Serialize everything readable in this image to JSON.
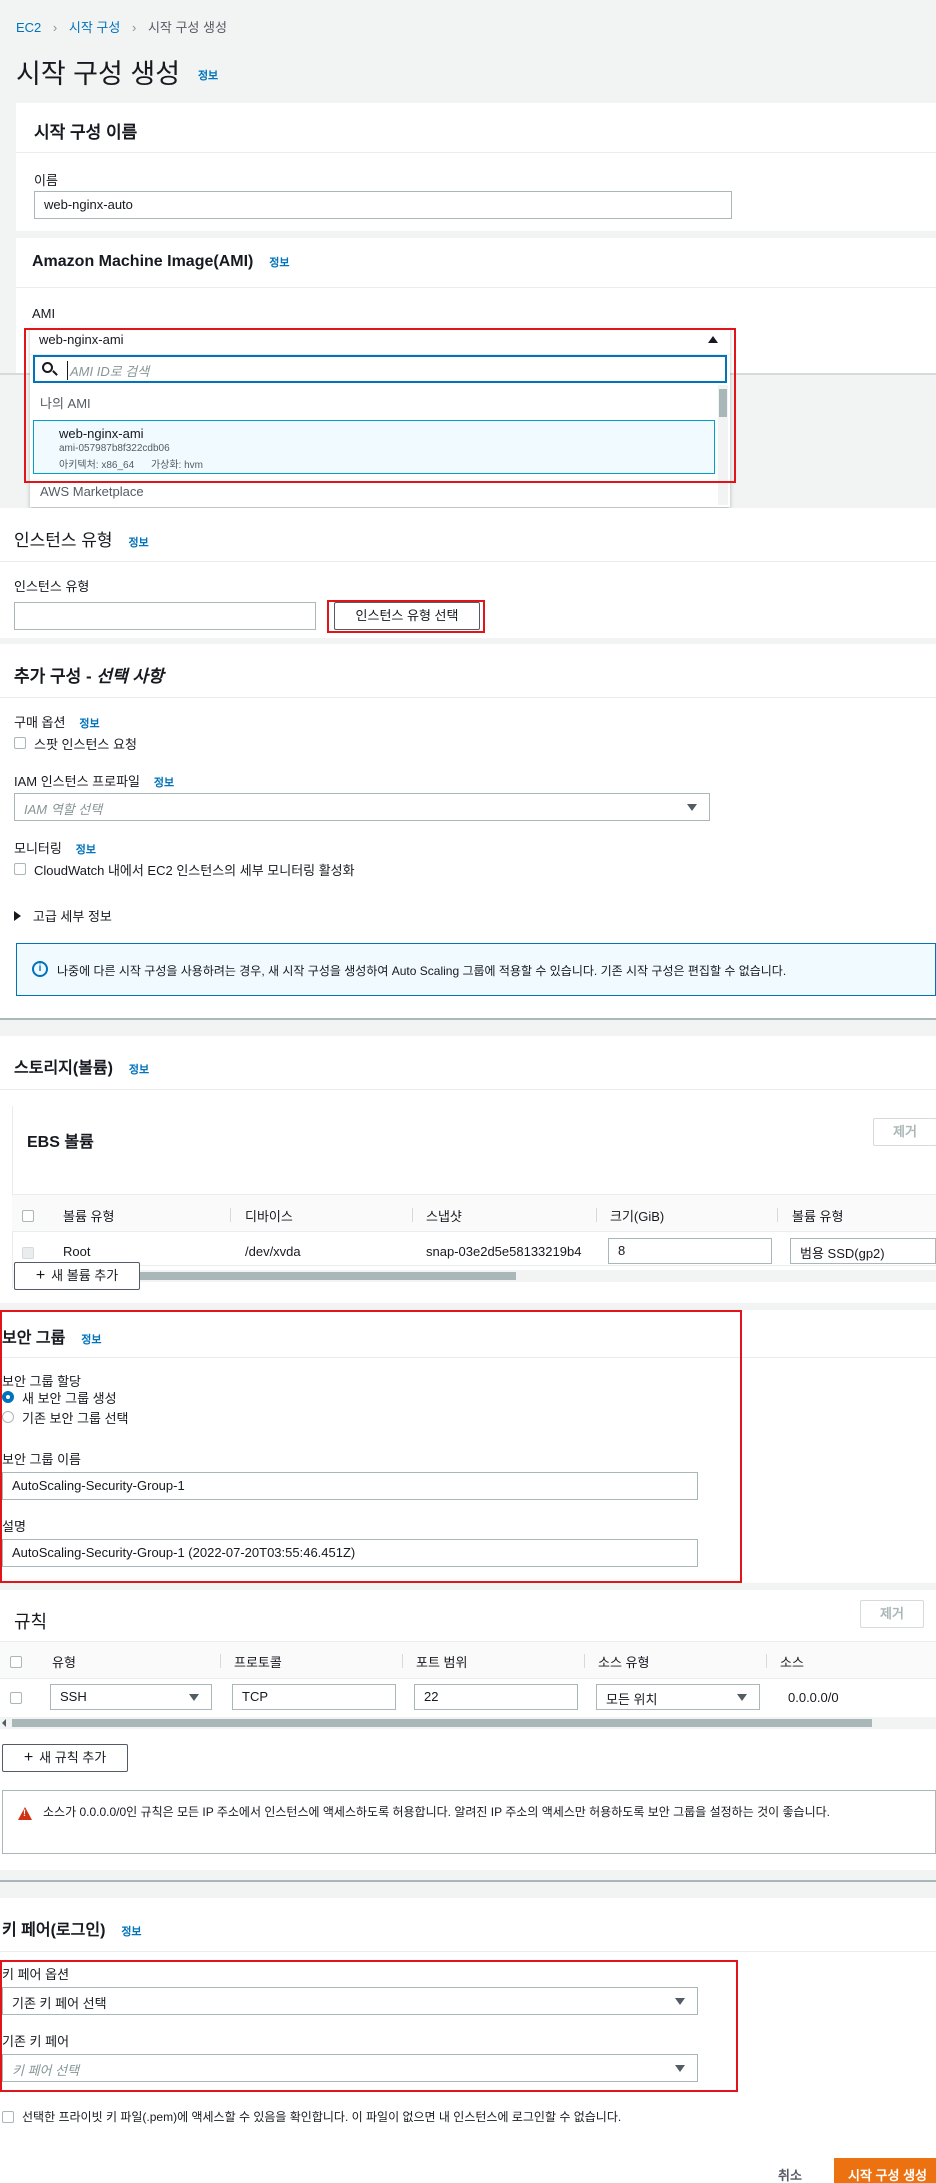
{
  "breadcrumb": [
    "EC2",
    "시작 구성",
    "시작 구성 생성"
  ],
  "page_title": "시작 구성 생성",
  "info_label": "정보",
  "name_section": {
    "title": "시작 구성 이름",
    "name_label": "이름",
    "name_value": "web-nginx-auto"
  },
  "ami_section": {
    "title": "Amazon Machine Image(AMI)",
    "ami_label": "AMI",
    "selected": "web-nginx-ami",
    "search_placeholder": "AMI ID로 검색",
    "group_my": "나의 AMI",
    "option": {
      "name": "web-nginx-ami",
      "id": "ami-057987b8f322cdb06",
      "arch": "아키텍처: x86_64",
      "virt": "가상화: hvm"
    },
    "group_marketplace": "AWS Marketplace"
  },
  "instance_section": {
    "title": "인스턴스 유형",
    "label": "인스턴스 유형",
    "button": "인스턴스 유형 선택"
  },
  "additional_section": {
    "title": "추가 구성 - ",
    "title_italic": "선택 사항",
    "purchase_label": "구매 옵션",
    "spot_label": "스팟 인스턴스 요청",
    "iam_label": "IAM 인스턴스 프로파일",
    "iam_placeholder": "IAM 역할 선택",
    "monitoring_label": "모니터링",
    "monitoring_check": "CloudWatch 내에서 EC2 인스턴스의 세부 모니터링 활성화",
    "advanced": "고급 세부 정보",
    "alert": "나중에 다른 시작 구성을 사용하려는 경우, 새 시작 구성을 생성하여 Auto Scaling 그룹에 적용할 수 있습니다. 기존 시작 구성은 편집할 수 없습니다."
  },
  "storage_section": {
    "title": "스토리지(볼륨)",
    "ebs_title": "EBS 볼륨",
    "remove": "제거",
    "columns": [
      "볼륨 유형",
      "디바이스",
      "스냅샷",
      "크기(GiB)",
      "볼륨 유형"
    ],
    "row": {
      "type": "Root",
      "device": "/dev/xvda",
      "snapshot": "snap-03e2d5e58133219b4",
      "size": "8",
      "volume_type": "범용 SSD(gp2)"
    },
    "add_button": "새 볼륨 추가"
  },
  "security_section": {
    "title": "보안 그룹",
    "assign_label": "보안 그룹 할당",
    "radio_new": "새 보안 그룹 생성",
    "radio_existing": "기존 보안 그룹 선택",
    "name_label": "보안 그룹 이름",
    "name_value": "AutoScaling-Security-Group-1",
    "desc_label": "설명",
    "desc_value": "AutoScaling-Security-Group-1 (2022-07-20T03:55:46.451Z)"
  },
  "rules_section": {
    "title": "규칙",
    "remove": "제거",
    "columns": [
      "유형",
      "프로토콜",
      "포트 범위",
      "소스 유형",
      "소스"
    ],
    "row": {
      "type": "SSH",
      "protocol": "TCP",
      "port": "22",
      "source_type": "모든 위치",
      "source": "0.0.0.0/0"
    },
    "add_button": "새 규칙 추가",
    "warning": "소스가 0.0.0.0/0인 규칙은 모든 IP 주소에서 인스턴스에 액세스하도록 허용합니다. 알려진 IP 주소의 액세스만 허용하도록 보안 그룹을 설정하는 것이 좋습니다."
  },
  "keypair_section": {
    "title": "키 페어(로그인)",
    "option_label": "키 페어 옵션",
    "option_value": "기존 키 페어 선택",
    "existing_label": "기존 키 페어",
    "existing_placeholder": "키 페어 선택",
    "ack": "선택한 프라이빗 키 파일(.pem)에 액세스할 수 있음을 확인합니다. 이 파일이 없으면 내 인스턴스에 로그인할 수 없습니다."
  },
  "footer": {
    "cancel": "취소",
    "create": "시작 구성 생성"
  }
}
